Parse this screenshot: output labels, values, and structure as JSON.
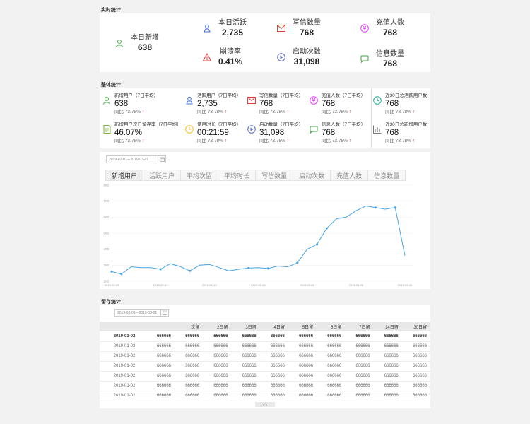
{
  "realtime": {
    "title": "实时统计",
    "items": [
      {
        "label": "本日新增",
        "value": "638",
        "icon": "user-icon",
        "color": "#4caf50"
      },
      {
        "label": "本日活跃",
        "value": "2,735",
        "icon": "active-user-icon",
        "color": "#3f6fd8"
      },
      {
        "label": "写信数量",
        "value": "768",
        "icon": "mail-icon",
        "color": "#e53935"
      },
      {
        "label": "充值人数",
        "value": "768",
        "icon": "yen-icon",
        "color": "#e040fb"
      },
      {
        "label": "崩溃率",
        "value": "0.41%",
        "icon": "warning-icon",
        "color": "#e53935"
      },
      {
        "label": "启动次数",
        "value": "31,098",
        "icon": "play-icon",
        "color": "#5c6bc0"
      },
      {
        "label": "信息数量",
        "value": "768",
        "icon": "message-icon",
        "color": "#43a047"
      }
    ]
  },
  "overall": {
    "title": "整体统计",
    "items": [
      {
        "label": "新增用户（7日平均）",
        "value": "638",
        "compare": "同比 73.78%",
        "icon": "user-icon",
        "color": "#4caf50"
      },
      {
        "label": "活跃用户（7日平均）",
        "value": "2,735",
        "compare": "同比 73.78%",
        "icon": "active-user-icon",
        "color": "#3f6fd8"
      },
      {
        "label": "写信数量（7日平均）",
        "value": "768",
        "compare": "同比 73.78%",
        "icon": "mail-icon",
        "color": "#e53935"
      },
      {
        "label": "充值人数（7日平均）",
        "value": "768",
        "compare": "同比 73.78%",
        "icon": "yen-icon",
        "color": "#e040fb"
      },
      {
        "label": "近30日总活跃用户数",
        "value": "768",
        "compare": "同比 73.78%",
        "icon": "clock-icon",
        "color": "#26a69a"
      },
      {
        "label": "新增用户次日留存率（7日平均）",
        "value": "46.07%",
        "compare": "同比 73.78%",
        "icon": "document-icon",
        "color": "#7cb342"
      },
      {
        "label": "使用时长（7日平均）",
        "value": "00:21:59",
        "compare": "同比 73.78%",
        "icon": "timer-icon",
        "color": "#fbc02d"
      },
      {
        "label": "启动数量（7日平均）",
        "value": "31,098",
        "compare": "同比 73.78%",
        "icon": "play-icon",
        "color": "#5c6bc0"
      },
      {
        "label": "信息人数（7日平均）",
        "value": "768",
        "compare": "同比 73.78%",
        "icon": "message-icon",
        "color": "#43a047"
      },
      {
        "label": "近30日总新增用户数",
        "value": "768",
        "compare": "同比 73.78%",
        "icon": "chart-icon",
        "color": "#777777"
      }
    ],
    "up_arrow": "↑"
  },
  "trend": {
    "date_range": "2019-02-01—2019-03-01",
    "tabs": [
      "新增用户",
      "活跃用户",
      "平均次留",
      "平均时长",
      "写信数量",
      "启动次数",
      "充值人数",
      "信息数量"
    ],
    "active_tab": 0
  },
  "chart_data": {
    "type": "line",
    "y_ticks": [
      "200",
      "300",
      "400",
      "500",
      "600",
      "700",
      "800"
    ],
    "ylim": [
      200,
      800
    ],
    "x_tick_labels": [
      "2019-02-09",
      "2019-02-14",
      "2019-02-19",
      "2019-02-24",
      "2019-03-01",
      "2019-03-06",
      "2019-03-11"
    ],
    "x_tick_index": [
      0,
      5,
      10,
      15,
      20,
      25,
      30
    ],
    "values": [
      260,
      245,
      290,
      285,
      285,
      275,
      310,
      292,
      265,
      300,
      305,
      285,
      265,
      275,
      282,
      285,
      280,
      295,
      290,
      315,
      400,
      430,
      530,
      590,
      600,
      640,
      670,
      660,
      650,
      660,
      360
    ],
    "marker_index": [
      0,
      1,
      5,
      8,
      14,
      16,
      19,
      21,
      22,
      27,
      29
    ],
    "color": "#4aa3df"
  },
  "retention": {
    "title": "留存统计",
    "date_range": "2019-02-01—2019-03-01",
    "headers": [
      "",
      "",
      "次留",
      "2日留",
      "3日留",
      "4日留",
      "5日留",
      "6日留",
      "7日留",
      "14日留",
      "30日留"
    ],
    "rows": [
      [
        "2019-01-02",
        "666666",
        "666666",
        "666666",
        "666666",
        "666666",
        "666666",
        "666666",
        "666666",
        "666666",
        "666666"
      ],
      [
        "2019-01-02",
        "666666",
        "666666",
        "666666",
        "666666",
        "666666",
        "666666",
        "666666",
        "666666",
        "666666",
        "666666"
      ],
      [
        "2019-01-02",
        "666666",
        "666666",
        "666666",
        "666666",
        "666666",
        "666666",
        "666666",
        "666666",
        "666666",
        "666666"
      ],
      [
        "2019-01-02",
        "666666",
        "666666",
        "666666",
        "666666",
        "666666",
        "666666",
        "666666",
        "666666",
        "666666",
        "666666"
      ],
      [
        "2019-01-02",
        "666666",
        "666666",
        "666666",
        "666666",
        "666666",
        "666666",
        "666666",
        "666666",
        "666666",
        "666666"
      ],
      [
        "2019-01-02",
        "666666",
        "666666",
        "666666",
        "666666",
        "666666",
        "666666",
        "666666",
        "666666",
        "666666",
        "666666"
      ],
      [
        "2019-01-02",
        "666666",
        "666666",
        "666666",
        "666666",
        "666666",
        "666666",
        "666666",
        "666666",
        "666666",
        "666666"
      ]
    ],
    "collapse_icon": "chevron-up-icon"
  }
}
